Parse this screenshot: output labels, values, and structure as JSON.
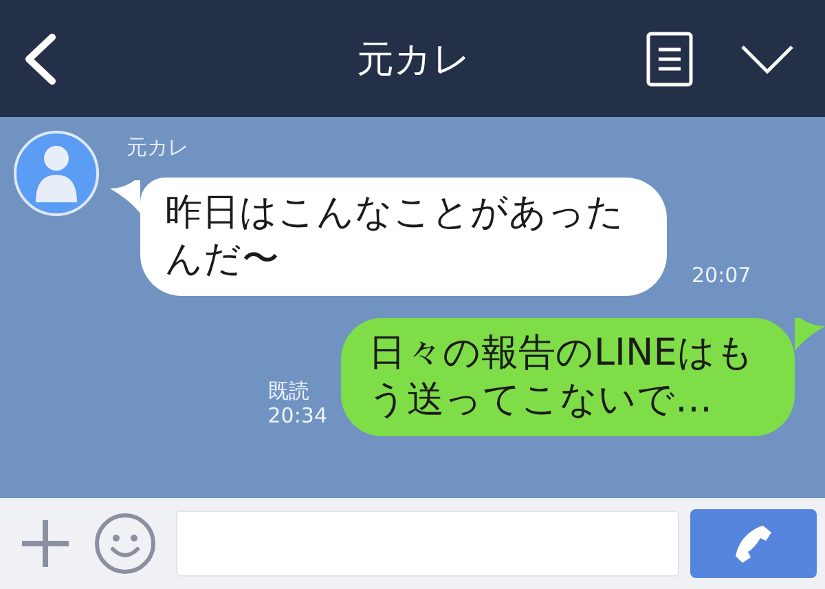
{
  "header": {
    "title": "元カレ"
  },
  "messages": [
    {
      "kind": "incoming",
      "sender": "元カレ",
      "text": "昨日はこんなことがあったんだ〜",
      "time": "20:07"
    },
    {
      "kind": "outgoing",
      "text": "日々の報告のLINEはもう送ってこないで…",
      "read": "既読",
      "time": "20:34"
    }
  ]
}
